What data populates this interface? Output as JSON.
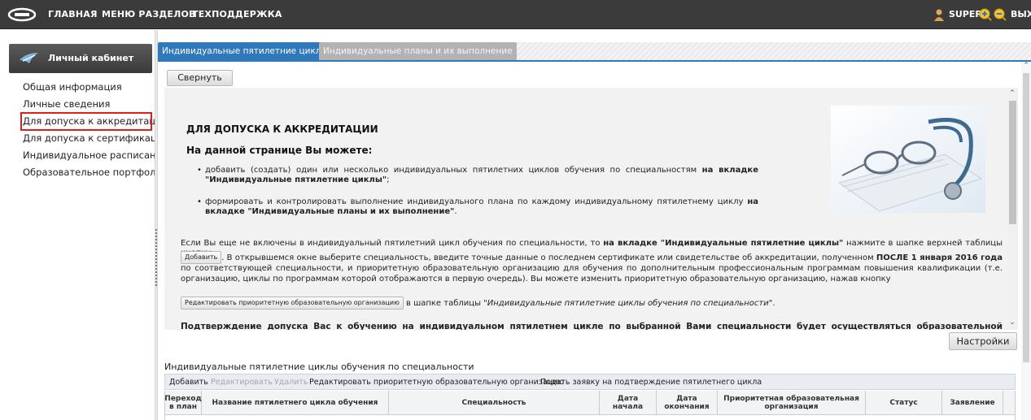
{
  "topbar": {
    "nav_home": "ГЛАВНАЯ",
    "nav_sections": "МЕНЮ РАЗДЕЛОВ",
    "nav_support": "ТЕХПОДДЕРЖКА",
    "user_name": "SUPER",
    "logout": "ВЫХОД",
    "bg_color": "#3b3b3b"
  },
  "sidebar": {
    "header_title": "Личный кабинет",
    "items": [
      {
        "label": "Общая информация"
      },
      {
        "label": "Личные сведения"
      },
      {
        "label": "Для допуска к аккредитации",
        "active": true
      },
      {
        "label": "Для допуска к сертификации"
      },
      {
        "label": "Индивидуальное расписание"
      },
      {
        "label": "Образовательное портфолио"
      }
    ]
  },
  "tabs": [
    {
      "label": "Индивидуальные пятилетние циклы",
      "active": true
    },
    {
      "label": "Индивидуальные планы и их выполнение",
      "active": false
    }
  ],
  "content": {
    "collapse_button": "Свернуть",
    "settings_button": "Настройки",
    "info": {
      "title": "ДЛЯ ДОПУСКА К АККРЕДИТАЦИИ",
      "subtitle": "На данной странице Вы можете:",
      "bullet1_text": "добавить (создать) один или несколько индивидуальных пятилетних циклов обучения по специальностям ",
      "bullet1_bold": "на вкладке \"Индивидуальные пятилетние циклы\"",
      "bullet1_tail": ";",
      "bullet2_text": "формировать и контролировать выполнение индивидуального плана по каждому индивидуальному пятилетнему циклу ",
      "bullet2_bold": "на вкладке \"Индивидуальные планы и их выполнение\"",
      "bullet2_tail": ".",
      "p1_a": "Если Вы еще не включены в индивидуальный пятилетний цикл обучения по специальности, то ",
      "p1_bold": "на вкладке \"Индивидуальные пятилетние циклы\"",
      "p1_b": " нажмите в шапке верхней таблицы кнопку",
      "inline_add": "Добавить",
      "p2_a": ". В открывшемся окне выберите специальность, введите точные данные о последнем сертификате или свидетельстве об аккредитации, полученном ",
      "p2_bold": "ПОСЛЕ 1 января 2016 года",
      "p2_b": " по соответствующей специальности, и приоритетную образовательную организацию для обучения по дополнительным профессиональным программам повышения квалификации (т.е. организацию, циклы по программам которой отображаются в первую очередь). Вы можете изменить приоритетную образовательную организацию, нажав кнопку",
      "inline_edit": "Редактировать приоритетную образовательную организацию",
      "p3_a": " в шапке таблицы ",
      "p3_italic": "\"Индивидуальные пятилетние циклы обучения по специальности\"",
      "p3_b": ".",
      "p4_bold": "Подтверждение допуска Вас к обучению на индивидуальном пятилетнем цикле по выбранной Вами специальности будет осуществляться образовательной организацией, в"
    }
  },
  "grid": {
    "title": "Индивидуальные пятилетние циклы обучения по специальности",
    "toolbar": {
      "add": "Добавить",
      "edit": "Редактировать",
      "delete": "Удалить",
      "edit_priority": "Редактировать приоритетную образовательную организацию",
      "submit": "Подать заявку на подтверждение пятилетнего цикла"
    },
    "columns": [
      {
        "label": "Переход в план"
      },
      {
        "label": "Название пятилетнего цикла обучения"
      },
      {
        "label": "Специальность"
      },
      {
        "label": "Дата начала"
      },
      {
        "label": "Дата окончания"
      },
      {
        "label": "Приоритетная образовательная организация"
      },
      {
        "label": "Статус"
      },
      {
        "label": "Заявление"
      }
    ]
  },
  "colors": {
    "accent": "#2f78b9",
    "highlight": "#e31b1b"
  }
}
